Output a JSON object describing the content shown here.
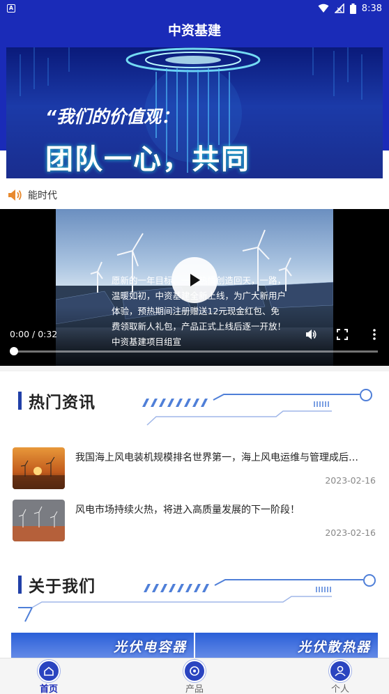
{
  "status_bar": {
    "time": "8:38",
    "left_icon": "A"
  },
  "header": {
    "title": "中资基建"
  },
  "banner": {
    "quote": "“我们的价值观：",
    "main": "团队一心，共同"
  },
  "notice": {
    "icon": "speaker-icon",
    "text": "能时代"
  },
  "video": {
    "caption": "愿新的一年目标、一起热情创造回天，一路，温暖如初，中资基建全新上线，为广大新用户体验，预热期间注册赠送12元现金红包、免费领取新人礼包，产品正式上线后逐一开放！中资基建项目组宣",
    "time": "0:00 / 0:32",
    "progress": 0
  },
  "hot_news": {
    "title": "热门资讯",
    "items": [
      {
        "title": "我国海上风电装机规模排名世界第一，海上风电运维与管理成后…",
        "date": "2023-02-16"
      },
      {
        "title": "风电市场持续火热，将进入高质量发展的下一阶段！",
        "date": "2023-02-16"
      }
    ]
  },
  "about": {
    "title": "关于我们",
    "cards": [
      {
        "label": "光伏电容器"
      },
      {
        "label": "光伏散热器"
      }
    ]
  },
  "bottom_nav": {
    "items": [
      {
        "label": "首页",
        "active": true
      },
      {
        "label": "产品",
        "active": false
      },
      {
        "label": "个人",
        "active": false
      }
    ]
  },
  "colors": {
    "brand": "#1a2bb8",
    "accent": "#2140a8"
  }
}
